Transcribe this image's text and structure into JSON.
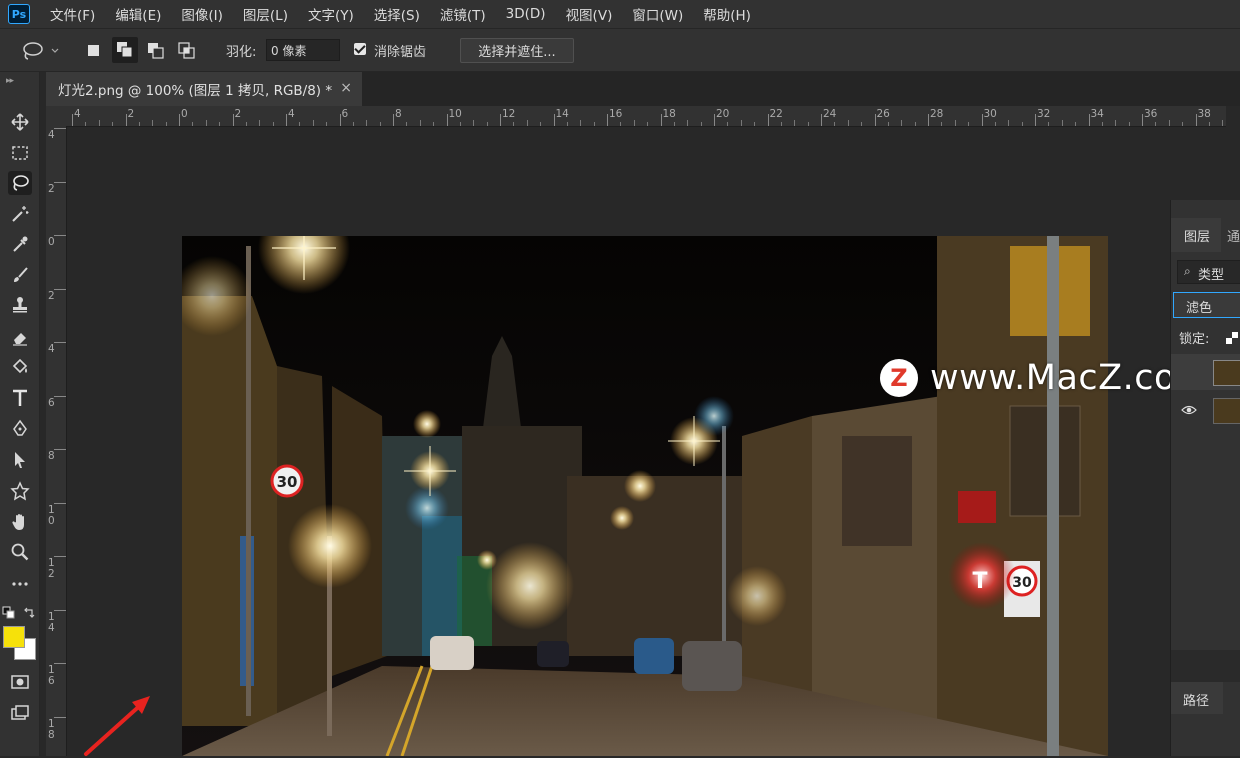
{
  "app": {
    "logo": "Ps"
  },
  "menu": [
    "文件(F)",
    "编辑(E)",
    "图像(I)",
    "图层(L)",
    "文字(Y)",
    "选择(S)",
    "滤镜(T)",
    "3D(D)",
    "视图(V)",
    "窗口(W)",
    "帮助(H)"
  ],
  "options": {
    "feather_label": "羽化:",
    "feather_value": "0 像素",
    "antialias_label": "消除锯齿",
    "antialias_checked": true,
    "select_mask_label": "选择并遮住..."
  },
  "tab": {
    "title": "灯光2.png @ 100% (图层 1 拷贝, RGB/8) *",
    "close": "×"
  },
  "ruler_top": [
    "4",
    "2",
    "0",
    "2",
    "4",
    "6",
    "8",
    "10",
    "12",
    "14",
    "16",
    "18",
    "20",
    "22",
    "24",
    "26",
    "28",
    "30",
    "32",
    "34",
    "36",
    "38"
  ],
  "ruler_left": [
    "4",
    "2",
    "0",
    "2",
    "4",
    "6",
    "8",
    "10",
    "12",
    "14",
    "16",
    "18"
  ],
  "layers_panel": {
    "tab_label": "图层",
    "tab2_label": "通",
    "filter_label": "类型",
    "blend_mode": "滤色",
    "lock_label": "锁定:"
  },
  "paths_panel": {
    "tab_label": "路径"
  },
  "watermark": {
    "logo": "Z",
    "text": "www.MacZ.com"
  },
  "colors": {
    "foreground": "#f6e10a",
    "background": "#ffffff",
    "arrow": "#e8231f"
  },
  "photo_signs": {
    "speed_limit": "30",
    "sign_letter": "T"
  }
}
